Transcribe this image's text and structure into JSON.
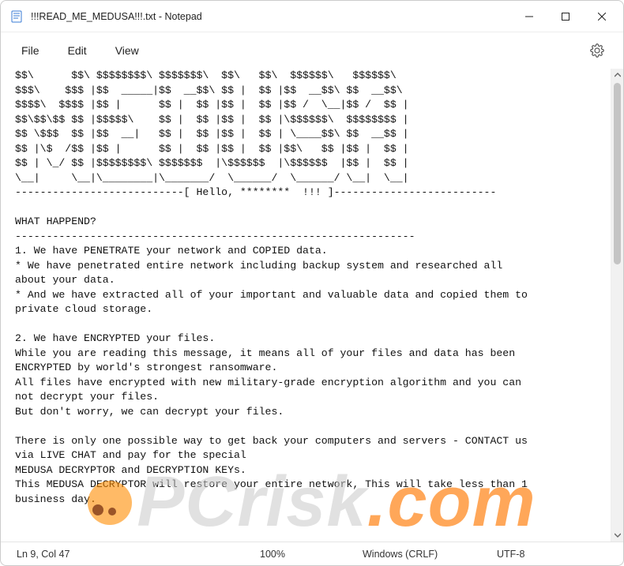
{
  "window": {
    "title": "!!!READ_ME_MEDUSA!!!.txt - Notepad"
  },
  "menu": {
    "file": "File",
    "edit": "Edit",
    "view": "View"
  },
  "document_lines": [
    "$$\\      $$\\ $$$$$$$$\\ $$$$$$$\\  $$\\   $$\\  $$$$$$\\   $$$$$$\\",
    "$$$\\    $$$ |$$  _____|$$  __$$\\ $$ |  $$ |$$  __$$\\ $$  __$$\\",
    "$$$$\\  $$$$ |$$ |      $$ |  $$ |$$ |  $$ |$$ /  \\__|$$ /  $$ |",
    "$$\\$$\\$$ $$ |$$$$$\\    $$ |  $$ |$$ |  $$ |\\$$$$$$\\  $$$$$$$$ |",
    "$$ \\$$$  $$ |$$  __|   $$ |  $$ |$$ |  $$ | \\____$$\\ $$  __$$ |",
    "$$ |\\$  /$$ |$$ |      $$ |  $$ |$$ |  $$ |$$\\   $$ |$$ |  $$ |",
    "$$ | \\_/ $$ |$$$$$$$$\\ $$$$$$$  |\\$$$$$$  |\\$$$$$$  |$$ |  $$ |",
    "\\__|     \\__|\\________|\\_______/  \\______/  \\______/ \\__|  \\__|",
    "---------------------------[ Hello, ********  !!! ]--------------------------",
    "",
    "WHAT HAPPEND?",
    "----------------------------------------------------------------",
    "1. We have PENETRATE your network and COPIED data.",
    "* We have penetrated entire network including backup system and researched all",
    "about your data.",
    "* And we have extracted all of your important and valuable data and copied them to",
    "private cloud storage.",
    "",
    "2. We have ENCRYPTED your files.",
    "While you are reading this message, it means all of your files and data has been",
    "ENCRYPTED by world's strongest ransomware.",
    "All files have encrypted with new military-grade encryption algorithm and you can",
    "not decrypt your files.",
    "But don't worry, we can decrypt your files.",
    "",
    "There is only one possible way to get back your computers and servers - CONTACT us",
    "via LIVE CHAT and pay for the special",
    "MEDUSA DECRYPTOR and DECRYPTION KEYs.",
    "This MEDUSA DECRYPTOR will restore your entire network, This will take less than 1",
    "business day."
  ],
  "status": {
    "cursor": "Ln 9, Col 47",
    "zoom": "100%",
    "line_ending": "Windows (CRLF)",
    "encoding": "UTF-8"
  },
  "watermark": {
    "brand": "PCrisk",
    "tld": ".com"
  }
}
